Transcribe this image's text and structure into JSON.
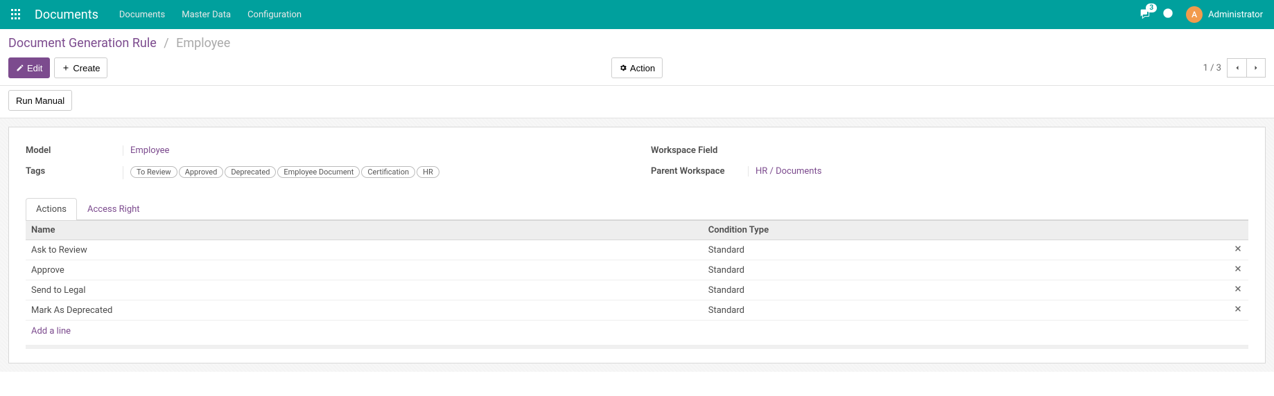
{
  "navbar": {
    "brand": "Documents",
    "links": [
      "Documents",
      "Master Data",
      "Configuration"
    ],
    "chat_count": "3",
    "user_initial": "A",
    "user_name": "Administrator"
  },
  "breadcrumb": {
    "parent": "Document Generation Rule",
    "sep": "/",
    "current": "Employee"
  },
  "buttons": {
    "edit": "Edit",
    "create": "Create",
    "action": "Action",
    "run_manual": "Run Manual"
  },
  "pager": {
    "text": "1 / 3"
  },
  "form": {
    "left": {
      "model_label": "Model",
      "model_value": "Employee",
      "tags_label": "Tags",
      "tags": [
        "To Review",
        "Approved",
        "Deprecated",
        "Employee Document",
        "Certification",
        "HR"
      ]
    },
    "right": {
      "workspace_field_label": "Workspace Field",
      "workspace_field_value": "",
      "parent_workspace_label": "Parent Workspace",
      "parent_workspace_value": "HR / Documents"
    }
  },
  "tabs": {
    "actions": "Actions",
    "access_right": "Access Right"
  },
  "table": {
    "col_name": "Name",
    "col_condition": "Condition Type",
    "rows": [
      {
        "name": "Ask to Review",
        "condition": "Standard"
      },
      {
        "name": "Approve",
        "condition": "Standard"
      },
      {
        "name": "Send to Legal",
        "condition": "Standard"
      },
      {
        "name": "Mark As Deprecated",
        "condition": "Standard"
      }
    ],
    "add_line": "Add a line"
  }
}
